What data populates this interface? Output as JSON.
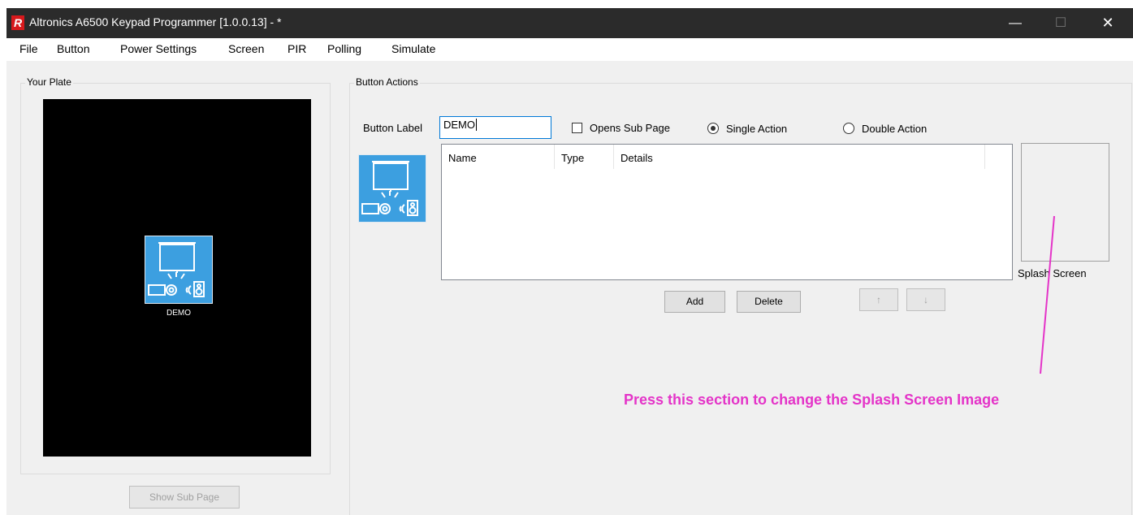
{
  "window": {
    "title": "Altronics A6500 Keypad Programmer [1.0.0.13]  - *",
    "logo_letter": "R",
    "controls": {
      "minimize": "—",
      "maximize": "☐",
      "close": "✕"
    }
  },
  "menu": {
    "items": [
      {
        "label": "File"
      },
      {
        "label": "Button"
      },
      {
        "label": "Power Settings"
      },
      {
        "label": "Screen"
      },
      {
        "label": "PIR"
      },
      {
        "label": "Polling"
      },
      {
        "label": "Simulate"
      }
    ]
  },
  "plate": {
    "group_title": "Your Plate",
    "button_label": "DEMO",
    "show_sub_page": "Show Sub Page"
  },
  "actions": {
    "group_title": "Button Actions",
    "button_label_caption": "Button Label",
    "button_label_value": "DEMO",
    "opens_sub_page": "Opens Sub Page",
    "single_action": "Single Action",
    "double_action": "Double Action",
    "columns": [
      "Name",
      "Type",
      "Details"
    ],
    "add": "Add",
    "delete": "Delete",
    "move_up": "↑",
    "move_down": "↓",
    "splash_screen": "Splash Screen"
  },
  "annotation": {
    "text": "Press this section to change the Splash Screen Image",
    "color": "#e434c8"
  },
  "colors": {
    "tile_blue": "#3c9fe0",
    "title_bar": "#2b2b2b",
    "window_bg": "#f0f0f0"
  }
}
